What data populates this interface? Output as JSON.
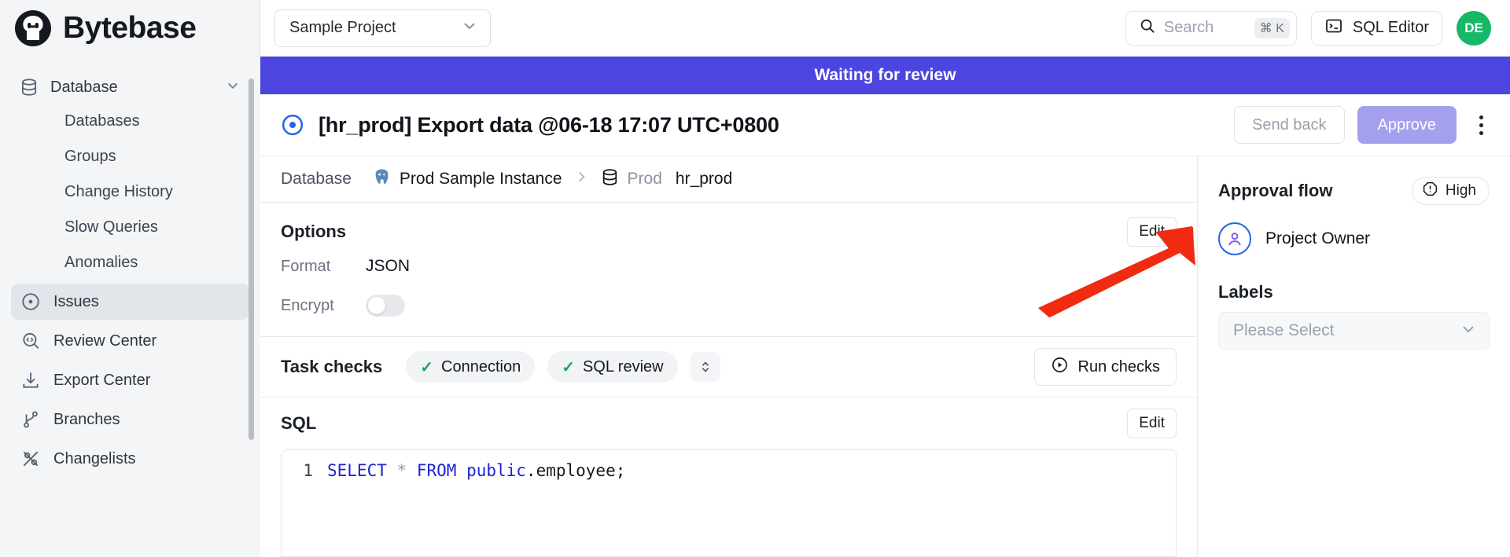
{
  "brand": {
    "name": "Bytebase",
    "logo_icon": "bytebase-logo-icon"
  },
  "sidebar": {
    "group": {
      "label": "Database",
      "icon": "database-icon",
      "chevron": "chevron-down-icon"
    },
    "sub_items": [
      {
        "label": "Databases"
      },
      {
        "label": "Groups"
      },
      {
        "label": "Change History"
      },
      {
        "label": "Slow Queries"
      },
      {
        "label": "Anomalies"
      }
    ],
    "items": [
      {
        "label": "Issues",
        "icon": "issue-circle-icon",
        "active": true
      },
      {
        "label": "Review Center",
        "icon": "review-search-icon",
        "active": false
      },
      {
        "label": "Export Center",
        "icon": "download-icon",
        "active": false
      },
      {
        "label": "Branches",
        "icon": "branch-icon",
        "active": false
      },
      {
        "label": "Changelists",
        "icon": "changelist-icon",
        "active": false
      }
    ]
  },
  "topbar": {
    "project": {
      "value": "Sample Project",
      "chevron": "chevron-down-icon"
    },
    "search": {
      "placeholder": "Search",
      "shortcut": "⌘ K",
      "icon": "search-icon"
    },
    "sql_editor": {
      "label": "SQL Editor",
      "icon": "terminal-icon"
    },
    "avatar": {
      "initials": "DE",
      "color": "#16b866"
    }
  },
  "banner": {
    "text": "Waiting for review",
    "color": "#4c45e0"
  },
  "issue": {
    "status_icon": "issue-open-circle-icon",
    "title": "[hr_prod] Export data @06-18 17:07 UTC+0800",
    "send_back_label": "Send back",
    "approve_label": "Approve",
    "more_icon": "more-vertical-icon"
  },
  "database_row": {
    "label": "Database",
    "instance": {
      "name": "Prod Sample Instance",
      "icon": "postgres-icon"
    },
    "separator": "❯",
    "database": {
      "env": "Prod",
      "name": "hr_prod",
      "icon": "database-icon"
    }
  },
  "options": {
    "title": "Options",
    "edit_label": "Edit",
    "format": {
      "key": "Format",
      "value": "JSON"
    },
    "encrypt": {
      "key": "Encrypt",
      "value": "off"
    }
  },
  "task_checks": {
    "title": "Task checks",
    "chips": [
      {
        "label": "Connection",
        "status": "passed",
        "check": "✓"
      },
      {
        "label": "SQL review",
        "status": "passed",
        "check": "✓"
      }
    ],
    "expand_icon": "chevron-up-down-icon",
    "run_checks_label": "Run checks",
    "run_icon": "play-circle-icon"
  },
  "sql": {
    "title": "SQL",
    "edit_label": "Edit",
    "lines": [
      {
        "number": "1",
        "tokens": [
          {
            "t": "SELECT",
            "c": "kw"
          },
          {
            "t": " ",
            "c": "plain"
          },
          {
            "t": "*",
            "c": "star"
          },
          {
            "t": " ",
            "c": "plain"
          },
          {
            "t": "FROM",
            "c": "kw"
          },
          {
            "t": " ",
            "c": "plain"
          },
          {
            "t": "public",
            "c": "kw"
          },
          {
            "t": ".employee;",
            "c": "plain"
          }
        ]
      }
    ],
    "text": "SELECT * FROM public.employee;"
  },
  "right_panel": {
    "approval_flow_title": "Approval flow",
    "priority": {
      "label": "High",
      "icon": "warning-octagon-icon"
    },
    "approvers": [
      {
        "name": "Project Owner",
        "icon": "user-circle-icon"
      }
    ],
    "labels_title": "Labels",
    "labels_select": {
      "placeholder": "Please Select",
      "chevron": "chevron-down-icon"
    }
  },
  "annotation": {
    "arrow_color": "#f02b12",
    "points_at": "options-edit-button"
  }
}
